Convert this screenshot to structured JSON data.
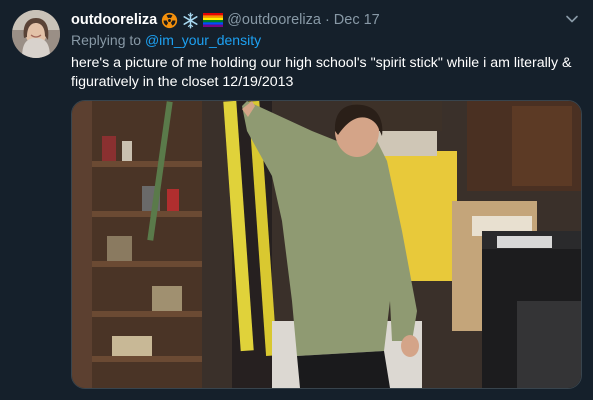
{
  "tweet": {
    "display_name": "outdooreliza",
    "emoji_icons": [
      "radioactive-icon",
      "snowflake-icon",
      "rainbow-flag-icon"
    ],
    "handle": "@outdooreliza",
    "separator": "·",
    "date": "Dec 17",
    "replying_prefix": "Replying to",
    "replying_to": "@im_your_density",
    "text": "here's a picture of me holding our high school's \"spirit stick\" while i am literally & figuratively in the closet 12/19/2013",
    "media_alt": "photo of a person in a supply closet holding a stick upward"
  },
  "colors": {
    "background": "#15202b",
    "secondary_text": "#8899a6",
    "link": "#1da1f2",
    "border": "#38444d"
  }
}
